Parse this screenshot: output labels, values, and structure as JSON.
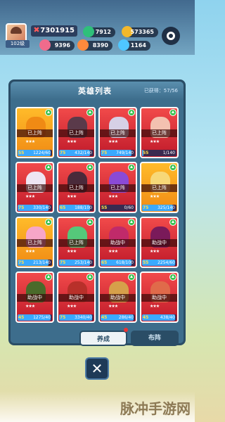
{
  "hud": {
    "power": "7301915",
    "gems": "7912",
    "coins": "573365",
    "level": "102级",
    "stamina1": "9396",
    "stamina2": "8390",
    "stamina3": "1164"
  },
  "panel": {
    "title": "英雄列表",
    "count": "已获得：57/56"
  },
  "cards": [
    {
      "style": "gold",
      "status": "已上阵",
      "level": "55",
      "progress": "1224/60",
      "fill": 0.95,
      "hero_color": "#f08a14"
    },
    {
      "style": "red",
      "status": "已上阵",
      "level": "75",
      "progress": "432/140",
      "fill": 0.9,
      "hero_color": "#5a3a4a"
    },
    {
      "style": "red",
      "status": "已上阵",
      "level": "75",
      "progress": "749/140",
      "fill": 0.9,
      "hero_color": "#d6d0e6"
    },
    {
      "style": "red",
      "status": "已上阵",
      "level": "55",
      "progress": "1/140",
      "fill": 0.05,
      "hero_color": "#f3c1b0"
    },
    {
      "style": "red",
      "status": "已上阵",
      "level": "75",
      "progress": "330/140",
      "fill": 0.9,
      "hero_color": "#eee4f2"
    },
    {
      "style": "red",
      "status": "已上阵",
      "level": "65",
      "progress": "188/100",
      "fill": 0.9,
      "hero_color": "#4a2a3a"
    },
    {
      "style": "red",
      "status": "已上阵",
      "level": "55",
      "progress": "0/60",
      "fill": 0.0,
      "hero_color": "#8a4ad6"
    },
    {
      "style": "gold",
      "status": "已上阵",
      "level": "75",
      "progress": "325/140",
      "fill": 0.9,
      "hero_color": "#f7d878"
    },
    {
      "style": "gold",
      "status": "已上阵",
      "level": "75",
      "progress": "213/140",
      "fill": 0.9,
      "hero_color": "#f7a6c8"
    },
    {
      "style": "red",
      "status": "已上阵",
      "level": "75",
      "progress": "253/140",
      "fill": 0.9,
      "hero_color": "#55c87a"
    },
    {
      "style": "red",
      "status": "助战中",
      "level": "65",
      "progress": "618/100",
      "fill": 0.9,
      "hero_color": "#c02a6a"
    },
    {
      "style": "red",
      "status": "助战中",
      "level": "55",
      "progress": "2254/60",
      "fill": 0.95,
      "hero_color": "#7a1a5a"
    },
    {
      "style": "red",
      "status": "助战中",
      "level": "45",
      "progress": "1275/40",
      "fill": 0.95,
      "hero_color": "#4a6a2a"
    },
    {
      "style": "red",
      "status": "助战中",
      "level": "75",
      "progress": "3340/40",
      "fill": 0.95,
      "hero_color": "#b8302a"
    },
    {
      "style": "red",
      "status": "助战中",
      "level": "45",
      "progress": "286/40",
      "fill": 0.95,
      "hero_color": "#d6a04a"
    },
    {
      "style": "red",
      "status": "助战中",
      "level": "45",
      "progress": "438/40",
      "fill": 0.95,
      "hero_color": "#e06a4a"
    }
  ],
  "tabs": {
    "train": "养成",
    "formation": "布阵"
  },
  "close_symbol": "✕",
  "watermark": "脉冲手游网"
}
